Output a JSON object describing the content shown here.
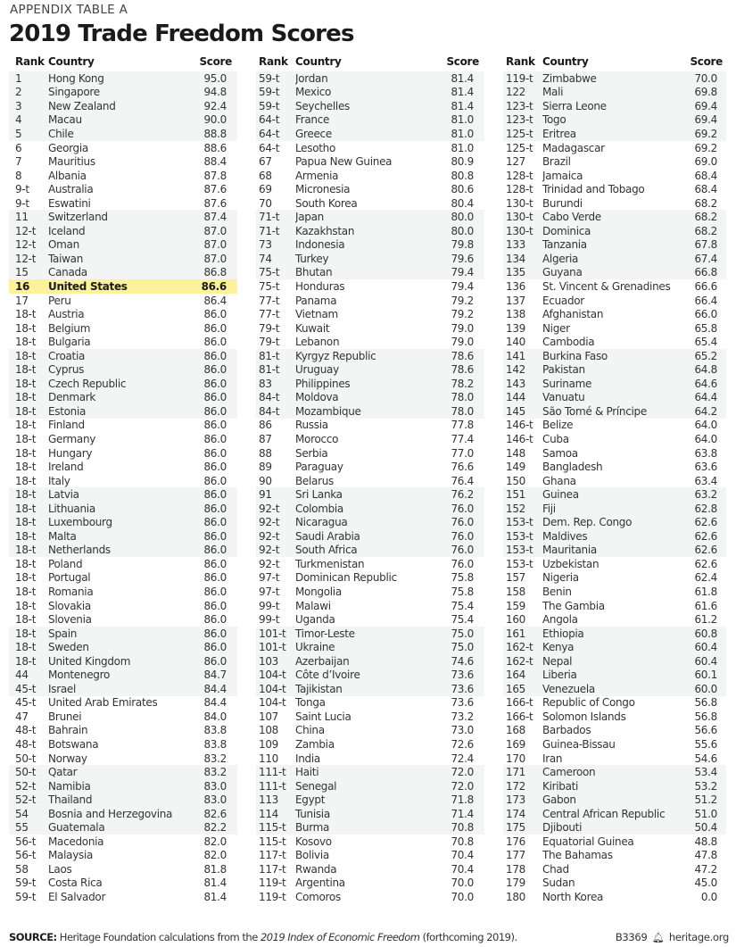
{
  "header": {
    "eyebrow": "APPENDIX TABLE A",
    "title": "2019 Trade Freedom Scores"
  },
  "columns": [
    "Rank",
    "Country",
    "Score"
  ],
  "highlight_color": "#fbf29b",
  "highlighted_country": "United States",
  "rows": [
    [
      "1",
      "Hong Kong",
      "95.0"
    ],
    [
      "2",
      "Singapore",
      "94.8"
    ],
    [
      "3",
      "New Zealand",
      "92.4"
    ],
    [
      "4",
      "Macau",
      "90.0"
    ],
    [
      "5",
      "Chile",
      "88.8"
    ],
    [
      "6",
      "Georgia",
      "88.6"
    ],
    [
      "7",
      "Mauritius",
      "88.4"
    ],
    [
      "8",
      "Albania",
      "87.8"
    ],
    [
      "9-t",
      "Australia",
      "87.6"
    ],
    [
      "9-t",
      "Eswatini",
      "87.6"
    ],
    [
      "11",
      "Switzerland",
      "87.4"
    ],
    [
      "12-t",
      "Iceland",
      "87.0"
    ],
    [
      "12-t",
      "Oman",
      "87.0"
    ],
    [
      "12-t",
      "Taiwan",
      "87.0"
    ],
    [
      "15",
      "Canada",
      "86.8"
    ],
    [
      "16",
      "United States",
      "86.6"
    ],
    [
      "17",
      "Peru",
      "86.4"
    ],
    [
      "18-t",
      "Austria",
      "86.0"
    ],
    [
      "18-t",
      "Belgium",
      "86.0"
    ],
    [
      "18-t",
      "Bulgaria",
      "86.0"
    ],
    [
      "18-t",
      "Croatia",
      "86.0"
    ],
    [
      "18-t",
      "Cyprus",
      "86.0"
    ],
    [
      "18-t",
      "Czech Republic",
      "86.0"
    ],
    [
      "18-t",
      "Denmark",
      "86.0"
    ],
    [
      "18-t",
      "Estonia",
      "86.0"
    ],
    [
      "18-t",
      "Finland",
      "86.0"
    ],
    [
      "18-t",
      "Germany",
      "86.0"
    ],
    [
      "18-t",
      "Hungary",
      "86.0"
    ],
    [
      "18-t",
      "Ireland",
      "86.0"
    ],
    [
      "18-t",
      "Italy",
      "86.0"
    ],
    [
      "18-t",
      "Latvia",
      "86.0"
    ],
    [
      "18-t",
      "Lithuania",
      "86.0"
    ],
    [
      "18-t",
      "Luxembourg",
      "86.0"
    ],
    [
      "18-t",
      "Malta",
      "86.0"
    ],
    [
      "18-t",
      "Netherlands",
      "86.0"
    ],
    [
      "18-t",
      "Poland",
      "86.0"
    ],
    [
      "18-t",
      "Portugal",
      "86.0"
    ],
    [
      "18-t",
      "Romania",
      "86.0"
    ],
    [
      "18-t",
      "Slovakia",
      "86.0"
    ],
    [
      "18-t",
      "Slovenia",
      "86.0"
    ],
    [
      "18-t",
      "Spain",
      "86.0"
    ],
    [
      "18-t",
      "Sweden",
      "86.0"
    ],
    [
      "18-t",
      "United Kingdom",
      "86.0"
    ],
    [
      "44",
      "Montenegro",
      "84.7"
    ],
    [
      "45-t",
      "Israel",
      "84.4"
    ],
    [
      "45-t",
      "United Arab Emirates",
      "84.4"
    ],
    [
      "47",
      "Brunei",
      "84.0"
    ],
    [
      "48-t",
      "Bahrain",
      "83.8"
    ],
    [
      "48-t",
      "Botswana",
      "83.8"
    ],
    [
      "50-t",
      "Norway",
      "83.2"
    ],
    [
      "50-t",
      "Qatar",
      "83.2"
    ],
    [
      "52-t",
      "Namibia",
      "83.0"
    ],
    [
      "52-t",
      "Thailand",
      "83.0"
    ],
    [
      "54",
      "Bosnia and Herzegovina",
      "82.6"
    ],
    [
      "55",
      "Guatemala",
      "82.2"
    ],
    [
      "56-t",
      "Macedonia",
      "82.0"
    ],
    [
      "56-t",
      "Malaysia",
      "82.0"
    ],
    [
      "58",
      "Laos",
      "81.8"
    ],
    [
      "59-t",
      "Costa Rica",
      "81.4"
    ],
    [
      "59-t",
      "El Salvador",
      "81.4"
    ],
    [
      "59-t",
      "Jordan",
      "81.4"
    ],
    [
      "59-t",
      "Mexico",
      "81.4"
    ],
    [
      "59-t",
      "Seychelles",
      "81.4"
    ],
    [
      "64-t",
      "France",
      "81.0"
    ],
    [
      "64-t",
      "Greece",
      "81.0"
    ],
    [
      "64-t",
      "Lesotho",
      "81.0"
    ],
    [
      "67",
      "Papua New Guinea",
      "80.9"
    ],
    [
      "68",
      "Armenia",
      "80.8"
    ],
    [
      "69",
      "Micronesia",
      "80.6"
    ],
    [
      "70",
      "South Korea",
      "80.4"
    ],
    [
      "71-t",
      "Japan",
      "80.0"
    ],
    [
      "71-t",
      "Kazakhstan",
      "80.0"
    ],
    [
      "73",
      "Indonesia",
      "79.8"
    ],
    [
      "74",
      "Turkey",
      "79.6"
    ],
    [
      "75-t",
      "Bhutan",
      "79.4"
    ],
    [
      "75-t",
      "Honduras",
      "79.4"
    ],
    [
      "77-t",
      "Panama",
      "79.2"
    ],
    [
      "77-t",
      "Vietnam",
      "79.2"
    ],
    [
      "79-t",
      "Kuwait",
      "79.0"
    ],
    [
      "79-t",
      "Lebanon",
      "79.0"
    ],
    [
      "81-t",
      "Kyrgyz Republic",
      "78.6"
    ],
    [
      "81-t",
      "Uruguay",
      "78.6"
    ],
    [
      "83",
      "Philippines",
      "78.2"
    ],
    [
      "84-t",
      "Moldova",
      "78.0"
    ],
    [
      "84-t",
      "Mozambique",
      "78.0"
    ],
    [
      "86",
      "Russia",
      "77.8"
    ],
    [
      "87",
      "Morocco",
      "77.4"
    ],
    [
      "88",
      "Serbia",
      "77.0"
    ],
    [
      "89",
      "Paraguay",
      "76.6"
    ],
    [
      "90",
      "Belarus",
      "76.4"
    ],
    [
      "91",
      "Sri Lanka",
      "76.2"
    ],
    [
      "92-t",
      "Colombia",
      "76.0"
    ],
    [
      "92-t",
      "Nicaragua",
      "76.0"
    ],
    [
      "92-t",
      "Saudi Arabia",
      "76.0"
    ],
    [
      "92-t",
      "South Africa",
      "76.0"
    ],
    [
      "92-t",
      "Turkmenistan",
      "76.0"
    ],
    [
      "97-t",
      "Dominican Republic",
      "75.8"
    ],
    [
      "97-t",
      "Mongolia",
      "75.8"
    ],
    [
      "99-t",
      "Malawi",
      "75.4"
    ],
    [
      "99-t",
      "Uganda",
      "75.4"
    ],
    [
      "101-t",
      "Timor-Leste",
      "75.0"
    ],
    [
      "101-t",
      "Ukraine",
      "75.0"
    ],
    [
      "103",
      "Azerbaijan",
      "74.6"
    ],
    [
      "104-t",
      "Côte d’Ivoire",
      "73.6"
    ],
    [
      "104-t",
      "Tajikistan",
      "73.6"
    ],
    [
      "104-t",
      "Tonga",
      "73.6"
    ],
    [
      "107",
      "Saint Lucia",
      "73.2"
    ],
    [
      "108",
      "China",
      "73.0"
    ],
    [
      "109",
      "Zambia",
      "72.6"
    ],
    [
      "110",
      "India",
      "72.4"
    ],
    [
      "111-t",
      "Haiti",
      "72.0"
    ],
    [
      "111-t",
      "Senegal",
      "72.0"
    ],
    [
      "113",
      "Egypt",
      "71.8"
    ],
    [
      "114",
      "Tunisia",
      "71.4"
    ],
    [
      "115-t",
      "Burma",
      "70.8"
    ],
    [
      "115-t",
      "Kosovo",
      "70.8"
    ],
    [
      "117-t",
      "Bolivia",
      "70.4"
    ],
    [
      "117-t",
      "Rwanda",
      "70.4"
    ],
    [
      "119-t",
      "Argentina",
      "70.0"
    ],
    [
      "119-t",
      "Comoros",
      "70.0"
    ],
    [
      "119-t",
      "Zimbabwe",
      "70.0"
    ],
    [
      "122",
      "Mali",
      "69.8"
    ],
    [
      "123-t",
      "Sierra Leone",
      "69.4"
    ],
    [
      "123-t",
      "Togo",
      "69.4"
    ],
    [
      "125-t",
      "Eritrea",
      "69.2"
    ],
    [
      "125-t",
      "Madagascar",
      "69.2"
    ],
    [
      "127",
      "Brazil",
      "69.0"
    ],
    [
      "128-t",
      "Jamaica",
      "68.4"
    ],
    [
      "128-t",
      "Trinidad and Tobago",
      "68.4"
    ],
    [
      "130-t",
      "Burundi",
      "68.2"
    ],
    [
      "130-t",
      "Cabo Verde",
      "68.2"
    ],
    [
      "130-t",
      "Dominica",
      "68.2"
    ],
    [
      "133",
      "Tanzania",
      "67.8"
    ],
    [
      "134",
      "Algeria",
      "67.4"
    ],
    [
      "135",
      "Guyana",
      "66.8"
    ],
    [
      "136",
      "St. Vincent & Grenadines",
      "66.6"
    ],
    [
      "137",
      "Ecuador",
      "66.4"
    ],
    [
      "138",
      "Afghanistan",
      "66.0"
    ],
    [
      "139",
      "Niger",
      "65.8"
    ],
    [
      "140",
      "Cambodia",
      "65.4"
    ],
    [
      "141",
      "Burkina Faso",
      "65.2"
    ],
    [
      "142",
      "Pakistan",
      "64.8"
    ],
    [
      "143",
      "Suriname",
      "64.6"
    ],
    [
      "144",
      "Vanuatu",
      "64.4"
    ],
    [
      "145",
      "São Tomé & Príncipe",
      "64.2"
    ],
    [
      "146-t",
      "Belize",
      "64.0"
    ],
    [
      "146-t",
      "Cuba",
      "64.0"
    ],
    [
      "148",
      "Samoa",
      "63.8"
    ],
    [
      "149",
      "Bangladesh",
      "63.6"
    ],
    [
      "150",
      "Ghana",
      "63.4"
    ],
    [
      "151",
      "Guinea",
      "63.2"
    ],
    [
      "152",
      "Fiji",
      "62.8"
    ],
    [
      "153-t",
      "Dem. Rep. Congo",
      "62.6"
    ],
    [
      "153-t",
      "Maldives",
      "62.6"
    ],
    [
      "153-t",
      "Mauritania",
      "62.6"
    ],
    [
      "153-t",
      "Uzbekistan",
      "62.6"
    ],
    [
      "157",
      "Nigeria",
      "62.4"
    ],
    [
      "158",
      "Benin",
      "61.8"
    ],
    [
      "159",
      "The Gambia",
      "61.6"
    ],
    [
      "160",
      "Angola",
      "61.2"
    ],
    [
      "161",
      "Ethiopia",
      "60.8"
    ],
    [
      "162-t",
      "Kenya",
      "60.4"
    ],
    [
      "162-t",
      "Nepal",
      "60.4"
    ],
    [
      "164",
      "Liberia",
      "60.1"
    ],
    [
      "165",
      "Venezuela",
      "60.0"
    ],
    [
      "166-t",
      "Republic of Congo",
      "56.8"
    ],
    [
      "166-t",
      "Solomon Islands",
      "56.8"
    ],
    [
      "168",
      "Barbados",
      "56.6"
    ],
    [
      "169",
      "Guinea-Bissau",
      "55.6"
    ],
    [
      "170",
      "Iran",
      "54.6"
    ],
    [
      "171",
      "Cameroon",
      "53.4"
    ],
    [
      "172",
      "Kiribati",
      "53.2"
    ],
    [
      "173",
      "Gabon",
      "51.2"
    ],
    [
      "174",
      "Central African Republic",
      "51.0"
    ],
    [
      "175",
      "Djibouti",
      "50.4"
    ],
    [
      "176",
      "Equatorial Guinea",
      "48.8"
    ],
    [
      "177",
      "The Bahamas",
      "47.8"
    ],
    [
      "178",
      "Chad",
      "47.2"
    ],
    [
      "179",
      "Sudan",
      "45.0"
    ],
    [
      "180",
      "North Korea",
      "0.0"
    ]
  ],
  "footer": {
    "source_label": "SOURCE:",
    "source_pre": " Heritage Foundation calculations from the ",
    "source_italic": "2019 Index of Economic Freedom",
    "source_post": " (forthcoming 2019).",
    "report_id": "B3369",
    "logo_icon": "liberty-bell-icon",
    "site": "heritage.org"
  }
}
